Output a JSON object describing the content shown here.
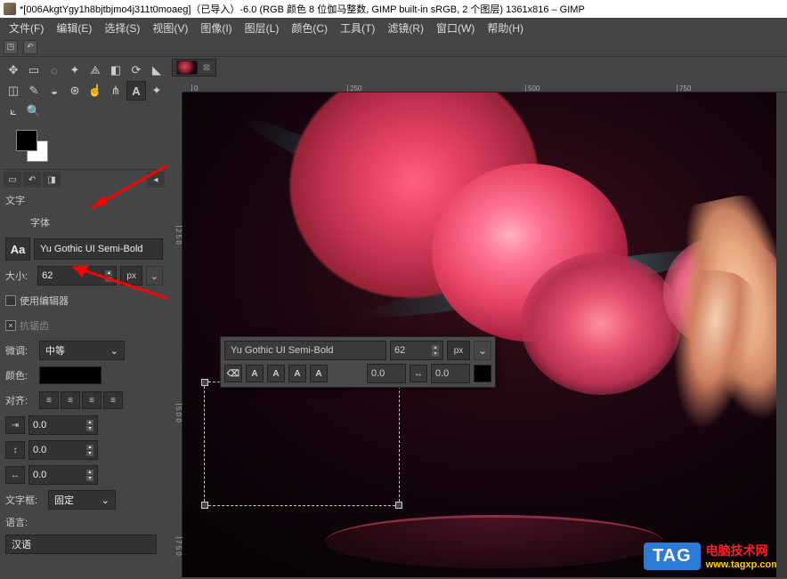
{
  "titlebar": "*[006AkgtYgy1h8bjtbjmo4j311t0moaeg]（已导入）-6.0 (RGB 颜色 8 位伽马整数, GIMP built-in sRGB, 2 个图层) 1361x816 – GIMP",
  "menus": [
    "文件(F)",
    "编辑(E)",
    "选择(S)",
    "视图(V)",
    "图像(I)",
    "图层(L)",
    "颜色(C)",
    "工具(T)",
    "滤镜(R)",
    "窗口(W)",
    "帮助(H)"
  ],
  "ruler_h": [
    "0",
    "250",
    "500",
    "750"
  ],
  "ruler_v": [
    "2 5 0",
    "5 0 0",
    "7 5 0"
  ],
  "text_panel": {
    "section": "文字",
    "font_label": "字体",
    "font_aa": "Aa",
    "font_name": "Yu Gothic UI Semi-Bold",
    "size_label": "大小:",
    "size_value": "62",
    "size_unit": "px",
    "use_editor": "使用编辑器",
    "antialias": "抗锯齿",
    "hinting_label": "微调:",
    "hinting_value": "中等",
    "color_label": "颜色:",
    "align_label": "对齐:",
    "indent_value": "0.0",
    "line_value": "0.0",
    "letter_value": "0.0",
    "textbox_label": "文字框:",
    "textbox_value": "固定",
    "lang_label": "语言:",
    "lang_value": "汉语"
  },
  "float": {
    "font": "Yu Gothic UI Semi-Bold",
    "size": "62",
    "unit": "px",
    "val1": "0.0",
    "val2": "0.0"
  },
  "tag": {
    "badge": "TAG",
    "line1": "电脑技术网",
    "line2": "www.tagxp.com"
  }
}
